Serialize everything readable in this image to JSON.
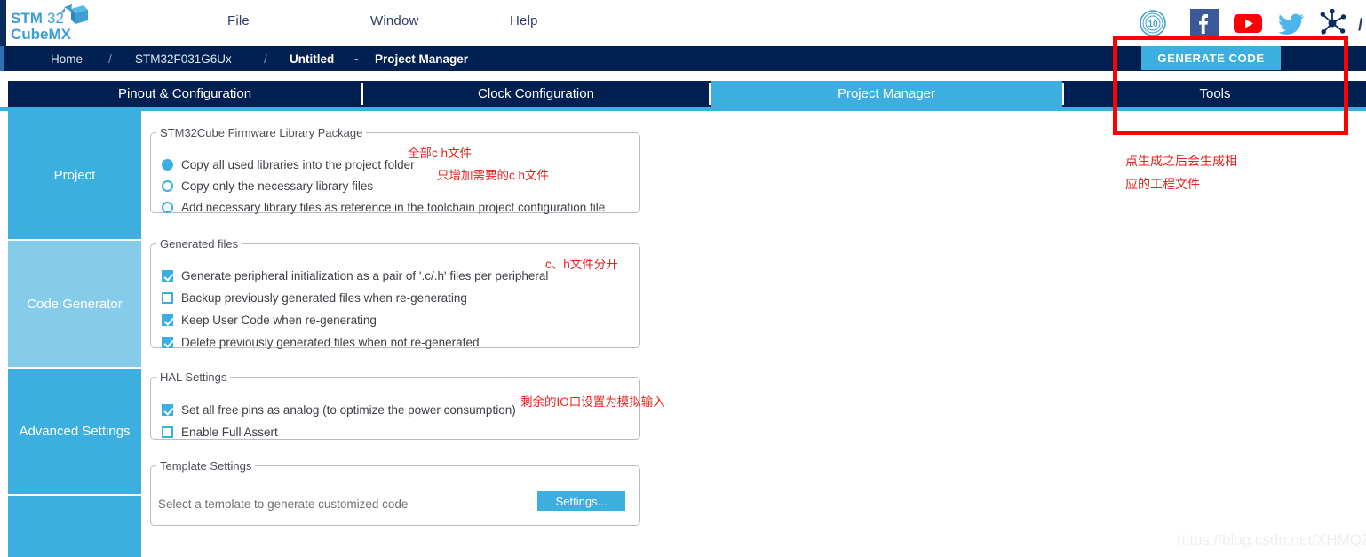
{
  "app": {
    "logo_line1": "STM32",
    "logo_line2": "CubeMX",
    "watermark": "https://blog.csdn.net/XHMQZ"
  },
  "menubar": {
    "items": [
      {
        "label": "File",
        "name": "menu-file"
      },
      {
        "label": "Window",
        "name": "menu-window"
      },
      {
        "label": "Help",
        "name": "menu-help"
      }
    ],
    "social_icons": [
      "st-10-years-badge-icon",
      "facebook-icon",
      "youtube-icon",
      "twitter-icon",
      "st-community-network-icon"
    ]
  },
  "breadcrumb": {
    "home": "Home",
    "sep1": "/",
    "mcu": "STM32F031G6Ux",
    "sep2": "/",
    "project": "Untitled",
    "dash": "-",
    "page": "Project Manager"
  },
  "toolbar": {
    "generate_code_label": "GENERATE CODE"
  },
  "tabs": [
    {
      "label": "Pinout & Configuration",
      "active": false
    },
    {
      "label": "Clock Configuration",
      "active": false
    },
    {
      "label": "Project Manager",
      "active": true
    },
    {
      "label": "Tools",
      "active": false
    }
  ],
  "sidebar": {
    "items": [
      {
        "label": "Project",
        "active": false
      },
      {
        "label": "Code Generator",
        "active": true
      },
      {
        "label": "Advanced Settings",
        "active": false
      },
      {
        "label": "",
        "active": false
      }
    ]
  },
  "firmware_group": {
    "legend": "STM32Cube Firmware Library Package",
    "options": [
      {
        "label": "Copy all used libraries into the project folder",
        "selected": true
      },
      {
        "label": "Copy only the necessary library files",
        "selected": false
      },
      {
        "label": "Add necessary library files as reference in the toolchain project configuration file",
        "selected": false
      }
    ],
    "notes": [
      "全部c h文件",
      "只增加需要的c h文件"
    ]
  },
  "generated_files_group": {
    "legend": "Generated files",
    "options": [
      {
        "label": "Generate peripheral initialization as a pair of '.c/.h' files per peripheral",
        "checked": true
      },
      {
        "label": "Backup previously generated files when re-generating",
        "checked": false
      },
      {
        "label": "Keep User Code when re-generating",
        "checked": true
      },
      {
        "label": "Delete previously generated files when not re-generated",
        "checked": true
      }
    ],
    "notes": [
      "c、h文件分开"
    ]
  },
  "hal_group": {
    "legend": "HAL Settings",
    "options": [
      {
        "label": "Set all free pins as analog (to optimize the power consumption)",
        "checked": true
      },
      {
        "label": "Enable Full Assert",
        "checked": false
      }
    ],
    "notes": [
      "剩余的IO口设置为模拟输入"
    ]
  },
  "template_group": {
    "legend": "Template Settings",
    "description": "Select a template to generate customized code",
    "button_label": "Settings..."
  },
  "annotations": {
    "generate_note_line1": "点生成之后会生成相",
    "generate_note_line2": "应的工程文件"
  },
  "colors": {
    "accent_blue": "#3daee0",
    "dark_navy": "#002052",
    "annotation_red": "#e8211b",
    "highlight_red": "#ff0000",
    "sidebar_active": "#84cce9"
  }
}
